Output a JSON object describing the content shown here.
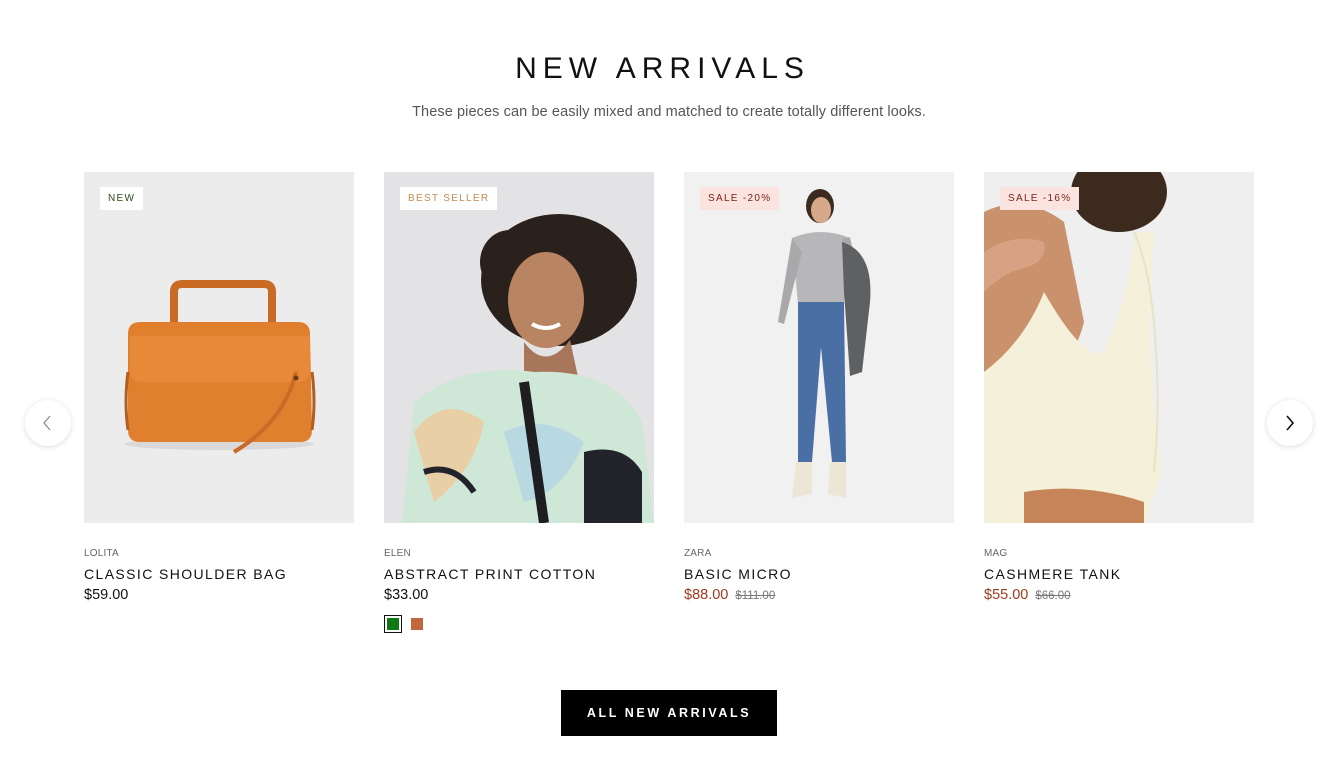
{
  "section": {
    "title": "NEW ARRIVALS",
    "subtitle": "These pieces can be easily mixed and matched to create totally different looks."
  },
  "carousel": {
    "prev_icon": "chevron-left-icon",
    "next_icon": "chevron-right-icon"
  },
  "products": [
    {
      "badge": "NEW",
      "brand": "LOLITA",
      "name": "CLASSIC SHOULDER BAG",
      "price": "$59.00",
      "old_price": ""
    },
    {
      "badge": "BEST SELLER",
      "brand": "ELEN",
      "name": "ABSTRACT PRINT COTTON",
      "price": "$33.00",
      "old_price": "",
      "swatches": [
        {
          "color": "#0f7a14",
          "selected": true
        },
        {
          "color": "#c0683a",
          "selected": false
        }
      ]
    },
    {
      "badge": "SALE -20%",
      "brand": "ZARA",
      "name": "BASIC MICRO",
      "price": "$88.00",
      "old_price": "$111.00"
    },
    {
      "badge": "SALE -16%",
      "brand": "MAG",
      "name": "CASHMERE TANK",
      "price": "$55.00",
      "old_price": "$66.00"
    }
  ],
  "cta": {
    "label": "ALL NEW ARRIVALS"
  },
  "colors": {
    "sale_price": "#9b3a1c",
    "sale_badge_bg": "#fbe4e0",
    "cta_bg": "#000000"
  }
}
